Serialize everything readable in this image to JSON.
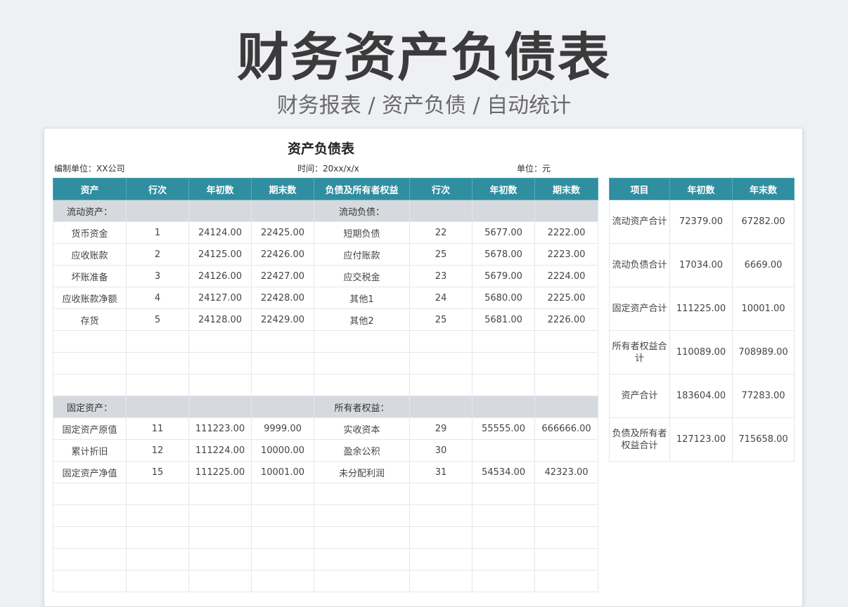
{
  "banner": {
    "title": "财务资产负债表",
    "subtitle": "财务报表 / 资产负债 / 自动统计"
  },
  "sheet": {
    "title": "资产负债表",
    "org_label": "编制单位：XX公司",
    "time_label": "时间：20xx/x/x",
    "unit_label": "单位：元"
  },
  "main_table": {
    "headers": [
      "资产",
      "行次",
      "年初数",
      "期末数",
      "负债及所有者权益",
      "行次",
      "年初数",
      "期末数"
    ],
    "rows": [
      [
        "流动资产：",
        "",
        "",
        "",
        "流动负债：",
        "",
        "",
        ""
      ],
      [
        "货币资金",
        "1",
        "24124.00",
        "22425.00",
        "短期负债",
        "22",
        "5677.00",
        "2222.00"
      ],
      [
        "应收账款",
        "2",
        "24125.00",
        "22426.00",
        "应付账款",
        "25",
        "5678.00",
        "2223.00"
      ],
      [
        "坏账准备",
        "3",
        "24126.00",
        "22427.00",
        "应交税金",
        "23",
        "5679.00",
        "2224.00"
      ],
      [
        "应收账款净额",
        "4",
        "24127.00",
        "22428.00",
        "其他1",
        "24",
        "5680.00",
        "2225.00"
      ],
      [
        "存货",
        "5",
        "24128.00",
        "22429.00",
        "其他2",
        "25",
        "5681.00",
        "2226.00"
      ],
      [
        "",
        "",
        "",
        "",
        "",
        "",
        "",
        ""
      ],
      [
        "",
        "",
        "",
        "",
        "",
        "",
        "",
        ""
      ],
      [
        "",
        "",
        "",
        "",
        "",
        "",
        "",
        ""
      ],
      [
        "固定资产：",
        "",
        "",
        "",
        "所有者权益：",
        "",
        "",
        ""
      ],
      [
        "固定资产原值",
        "11",
        "111223.00",
        "9999.00",
        "实收资本",
        "29",
        "55555.00",
        "666666.00"
      ],
      [
        "累计折旧",
        "12",
        "111224.00",
        "10000.00",
        "盈余公积",
        "30",
        "",
        ""
      ],
      [
        "固定资产净值",
        "15",
        "111225.00",
        "10001.00",
        "未分配利润",
        "31",
        "54534.00",
        "42323.00"
      ],
      [
        "",
        "",
        "",
        "",
        "",
        "",
        "",
        ""
      ],
      [
        "",
        "",
        "",
        "",
        "",
        "",
        "",
        ""
      ],
      [
        "",
        "",
        "",
        "",
        "",
        "",
        "",
        ""
      ],
      [
        "",
        "",
        "",
        "",
        "",
        "",
        "",
        ""
      ],
      [
        "",
        "",
        "",
        "",
        "",
        "",
        "",
        ""
      ]
    ]
  },
  "summary_table": {
    "headers": [
      "项目",
      "年初数",
      "年末数"
    ],
    "rows": [
      [
        "流动资产合计",
        "72379.00",
        "67282.00"
      ],
      [
        "流动负债合计",
        "17034.00",
        "6669.00"
      ],
      [
        "固定资产合计",
        "111225.00",
        "10001.00"
      ],
      [
        "所有者权益合计",
        "110089.00",
        "708989.00"
      ],
      [
        "资产合计",
        "183604.00",
        "77283.00"
      ],
      [
        "负债及所有者权益合计",
        "127123.00",
        "715658.00"
      ]
    ]
  },
  "colors": {
    "header_teal": "#2f8ea0",
    "section_gray": "#d6d9dd"
  }
}
